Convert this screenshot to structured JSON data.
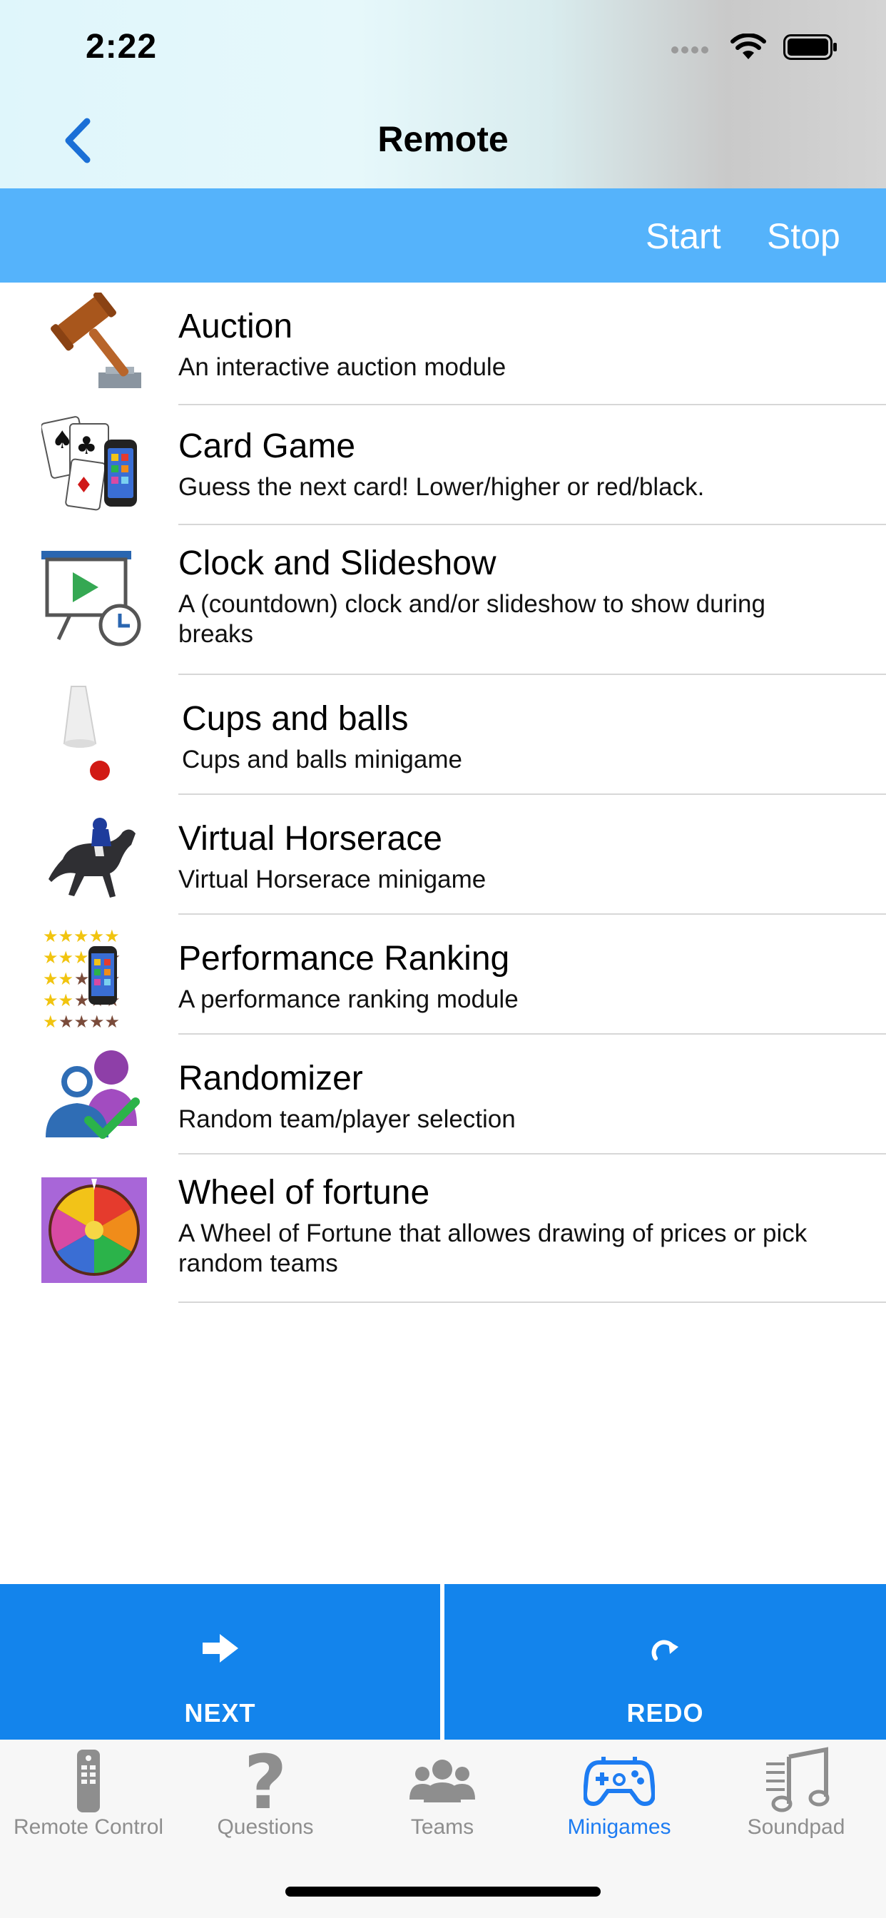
{
  "status": {
    "time": "2:22"
  },
  "nav": {
    "title": "Remote"
  },
  "toolbar": {
    "start": "Start",
    "stop": "Stop"
  },
  "minigames": [
    {
      "title": "Auction",
      "subtitle": "An interactive auction module",
      "icon": "gavel-icon"
    },
    {
      "title": "Card Game",
      "subtitle": "Guess the next card! Lower/higher or red/black.",
      "icon": "playing-cards-icon"
    },
    {
      "title": "Clock and Slideshow",
      "subtitle": "A (countdown) clock and/or slideshow to show during breaks",
      "icon": "presentation-clock-icon"
    },
    {
      "title": "Cups and balls",
      "subtitle": "Cups and balls minigame",
      "icon": "cup-ball-icon"
    },
    {
      "title": "Virtual Horserace",
      "subtitle": "Virtual Horserace minigame",
      "icon": "racehorse-icon"
    },
    {
      "title": "Performance Ranking",
      "subtitle": "A performance ranking module",
      "icon": "star-rating-icon"
    },
    {
      "title": "Randomizer",
      "subtitle": "Random team/player selection",
      "icon": "users-check-icon"
    },
    {
      "title": "Wheel of fortune",
      "subtitle": "A Wheel of Fortune that allowes drawing of prices or pick random teams",
      "icon": "fortune-wheel-icon"
    }
  ],
  "actions": {
    "next": "NEXT",
    "redo": "REDO"
  },
  "tabs": [
    {
      "label": "Remote Control",
      "icon": "remote-icon",
      "active": false
    },
    {
      "label": "Questions",
      "icon": "question-mark-icon",
      "active": false
    },
    {
      "label": "Teams",
      "icon": "team-icon",
      "active": false
    },
    {
      "label": "Minigames",
      "icon": "gamepad-icon",
      "active": true
    },
    {
      "label": "Soundpad",
      "icon": "music-note-icon",
      "active": false
    }
  ],
  "colors": {
    "toolbar": "#55b3fb",
    "action": "#1384ec",
    "tab_active": "#1d7cf2",
    "tab_inactive": "#8e8e8e"
  }
}
